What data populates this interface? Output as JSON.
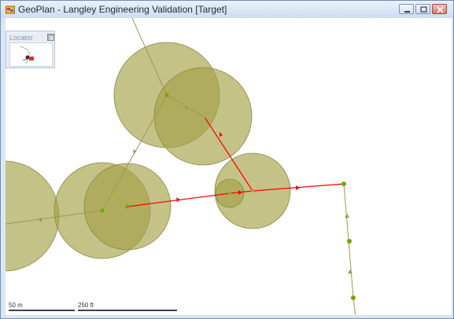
{
  "window": {
    "title": "GeoPlan - Langley Engineering Validation [Target]",
    "controls": [
      "minimize",
      "maximize",
      "close"
    ]
  },
  "locator": {
    "label": "Locator",
    "close_icon": "close-icon"
  },
  "scalebar": {
    "metric_label": "50 m",
    "imperial_label": "250 ft"
  },
  "colors": {
    "buffer_fill": "#a4a246",
    "link_red": "#ff0000",
    "link_olive": "#9a9a52",
    "node_green": "#6fa800",
    "background": "#ffffff"
  }
}
